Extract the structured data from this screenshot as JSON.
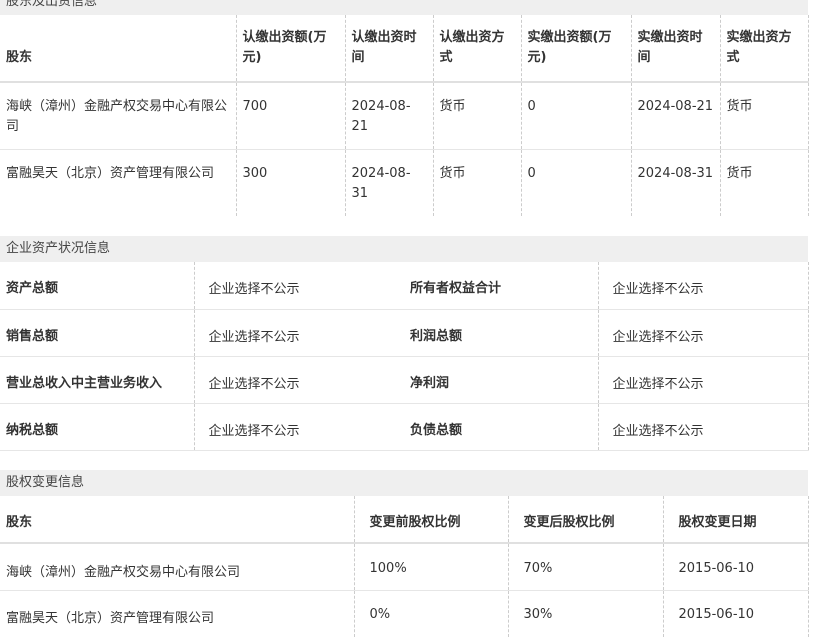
{
  "shareholder_section": {
    "title": "股东及出资信息",
    "headers": [
      "股东",
      "认缴出资额(万元)",
      "认缴出资时间",
      "认缴出资方式",
      "实缴出资额(万元)",
      "实缴出资时间",
      "实缴出资方式"
    ],
    "rows": [
      [
        "海峡（漳州）金融产权交易中心有限公司",
        "700",
        "2024-08-21",
        "货币",
        "0",
        "2024-08-21",
        "货币"
      ],
      [
        "富融昊天（北京）资产管理有限公司",
        "300",
        "2024-08-31",
        "货币",
        "0",
        "2024-08-31",
        "货币"
      ]
    ]
  },
  "assets_section": {
    "title": "企业资产状况信息",
    "rows": [
      [
        "资产总额",
        "企业选择不公示",
        "所有者权益合计",
        "企业选择不公示"
      ],
      [
        "销售总额",
        "企业选择不公示",
        "利润总额",
        "企业选择不公示"
      ],
      [
        "营业总收入中主营业务收入",
        "企业选择不公示",
        "净利润",
        "企业选择不公示"
      ],
      [
        "纳税总额",
        "企业选择不公示",
        "负债总额",
        "企业选择不公示"
      ]
    ]
  },
  "equity_change_section": {
    "title": "股权变更信息",
    "headers": [
      "股东",
      "变更前股权比例",
      "变更后股权比例",
      "股权变更日期"
    ],
    "rows": [
      [
        "海峡（漳州）金融产权交易中心有限公司",
        "100%",
        "70%",
        "2015-06-10"
      ],
      [
        "富融昊天（北京）资产管理有限公司",
        "0%",
        "30%",
        "2015-06-10"
      ]
    ]
  }
}
